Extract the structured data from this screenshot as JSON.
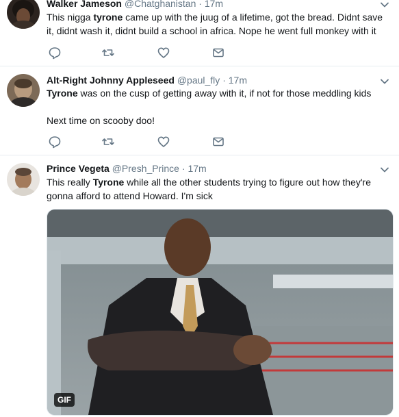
{
  "tweets": [
    {
      "name": "Walker Jameson",
      "handle": "@Chatghanistan",
      "time": "17m",
      "text_parts": [
        "This nigga ",
        "tyrone",
        " came up with the juug of a lifetime, got the bread. Didnt save it, didnt wash it, didnt build a school in africa. Nope he went full monkey with it"
      ]
    },
    {
      "name": "Alt-Right Johnny Appleseed",
      "handle": "@paul_fly",
      "time": "17m",
      "text_parts": [
        "Tyrone",
        " was on the cusp of getting away with it, if not for those meddling kids"
      ],
      "text_line2": "Next time on scooby doo!"
    },
    {
      "name": "Prince Vegeta",
      "handle": "@Presh_Prince",
      "time": "17m",
      "text_parts": [
        "This really ",
        "Tyrone",
        " while all the other students trying to figure out how they're gonna afford to attend Howard. I'm sick"
      ],
      "media_badge": "GIF"
    }
  ],
  "separator": "·",
  "icons": [
    "reply-icon",
    "retweet-icon",
    "like-icon",
    "direct-message-icon",
    "chevron-down-icon"
  ],
  "colors": {
    "text": "#14171a",
    "secondary": "#657786",
    "divider": "#e6ecf0"
  }
}
